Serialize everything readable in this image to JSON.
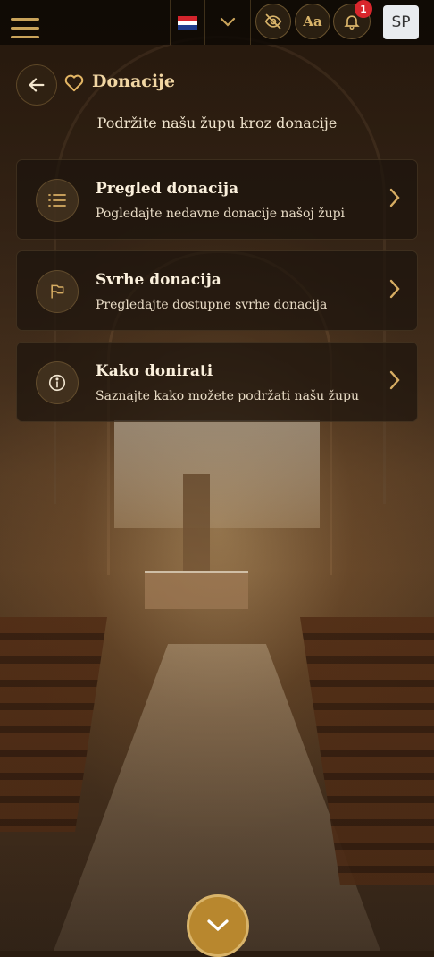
{
  "topbar": {
    "language_flag": "croatia-flag",
    "notification_count": "1",
    "font_size_label": "Aa",
    "avatar_initials": "SP"
  },
  "page": {
    "title": "Donacije",
    "subtitle": "Podržite našu župu kroz donacije"
  },
  "cards": [
    {
      "icon": "list-icon",
      "title": "Pregled donacija",
      "description": "Pogledajte nedavne donacije našoj župi"
    },
    {
      "icon": "flag-icon",
      "title": "Svrhe donacija",
      "description": "Pregledajte dostupne svrhe donacija"
    },
    {
      "icon": "info-icon",
      "title": "Kako donirati",
      "description": "Saznajte kako možete podržati našu župu"
    }
  ],
  "colors": {
    "accent": "#c9a35a",
    "badge": "#d9262c",
    "fab": "#b8872e"
  }
}
